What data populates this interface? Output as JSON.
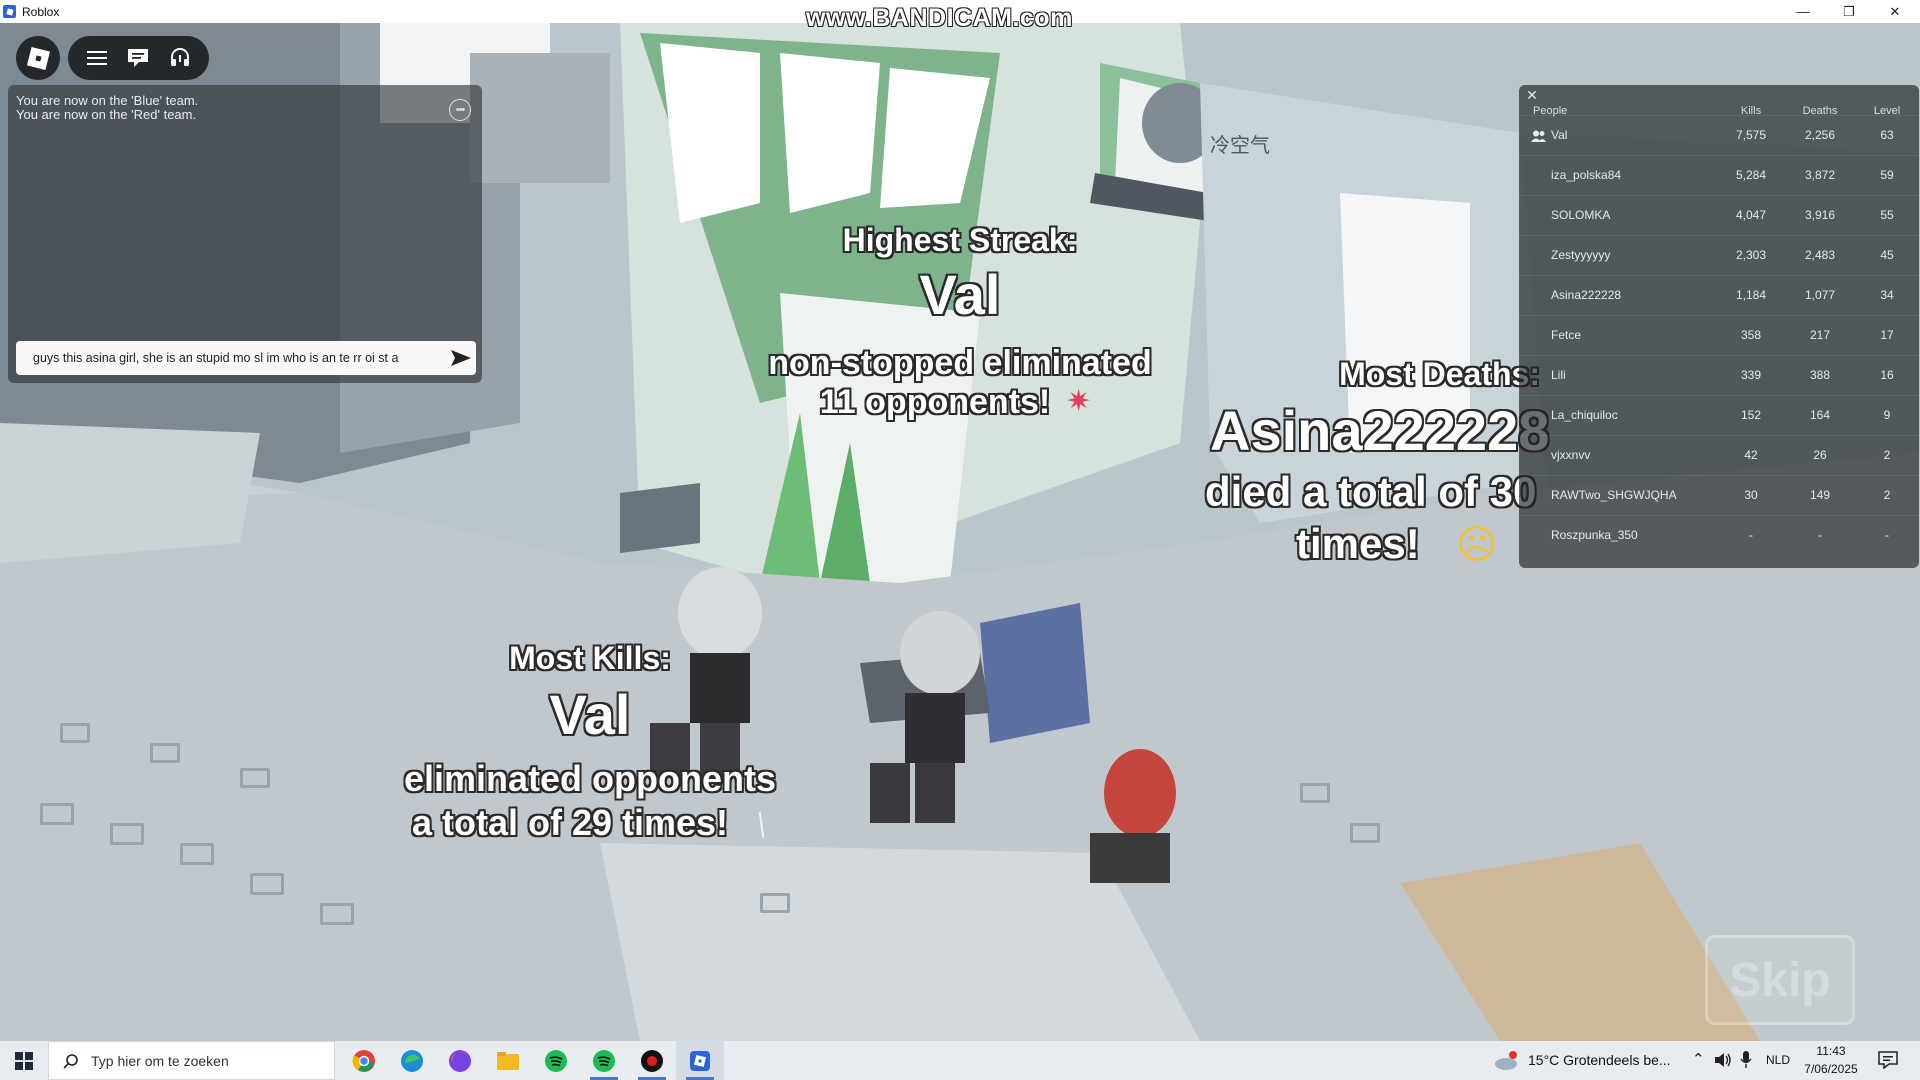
{
  "window": {
    "title": "Roblox",
    "watermark": "www.BANDICAM.com",
    "minimize": "—",
    "restore": "❐",
    "close": "✕"
  },
  "topbar": {
    "menu_icon": "hamburger-icon",
    "chat_icon": "chat-icon",
    "voice_icon": "headset-icon"
  },
  "chat": {
    "messages": [
      "You are now on the 'Blue' team.",
      "You are now on the 'Red' team."
    ],
    "more_glyph": "•••",
    "input_value": "guys this asina girl, she is an stupid mo sl im who is an te rr oi st a"
  },
  "awards": {
    "streak": {
      "title": "Highest Streak:",
      "name": "Val",
      "line1": "non-stopped eliminated",
      "line2": "11 opponents!"
    },
    "deaths": {
      "title": "Most Deaths:",
      "name": "Asina222228",
      "line1": "died a total of 30",
      "line2": "times!"
    },
    "kills": {
      "title": "Most Kills:",
      "name": "Val",
      "line1": "eliminated opponents",
      "line2": "a total of 29 times!"
    }
  },
  "skip_label": "Skip",
  "leaderboard": {
    "close": "✕",
    "headers": {
      "people": "People",
      "kills": "Kills",
      "deaths": "Deaths",
      "level": "Level"
    },
    "rows": [
      {
        "name": "Val",
        "kills": "7,575",
        "deaths": "2,256",
        "level": "63",
        "friend": true
      },
      {
        "name": "iza_polska84",
        "kills": "5,284",
        "deaths": "3,872",
        "level": "59"
      },
      {
        "name": "SOLOMKA",
        "kills": "4,047",
        "deaths": "3,916",
        "level": "55"
      },
      {
        "name": "Zestyyyyyy",
        "kills": "2,303",
        "deaths": "2,483",
        "level": "45"
      },
      {
        "name": "Asina222228",
        "kills": "1,184",
        "deaths": "1,077",
        "level": "34"
      },
      {
        "name": "Fetce",
        "kills": "358",
        "deaths": "217",
        "level": "17"
      },
      {
        "name": "Lili",
        "kills": "339",
        "deaths": "388",
        "level": "16"
      },
      {
        "name": "La_chiquiloc",
        "kills": "152",
        "deaths": "164",
        "level": "9"
      },
      {
        "name": "vjxxnvv",
        "kills": "42",
        "deaths": "26",
        "level": "2"
      },
      {
        "name": "RAWTwo_SHGWJQHA",
        "kills": "30",
        "deaths": "149",
        "level": "2"
      },
      {
        "name": "Roszpunka_350",
        "kills": "-",
        "deaths": "-",
        "level": "-"
      }
    ]
  },
  "scene_sign": "冷空气",
  "taskbar": {
    "search_placeholder": "Typ hier om te zoeken",
    "weather": "15°C  Grotendeels be...",
    "language": "NLD",
    "time": "11:43",
    "date": "7/06/2025",
    "apps": [
      "chrome-icon",
      "edge-icon",
      "firefox-icon",
      "file-explorer-icon",
      "spotify-icon",
      "spotify-icon",
      "bandicam-icon",
      "roblox-icon"
    ]
  },
  "colors": {
    "accent_blue": "#2b63d9",
    "panel_dark": "#1e2125",
    "taskbar": "#e8ecf0"
  }
}
